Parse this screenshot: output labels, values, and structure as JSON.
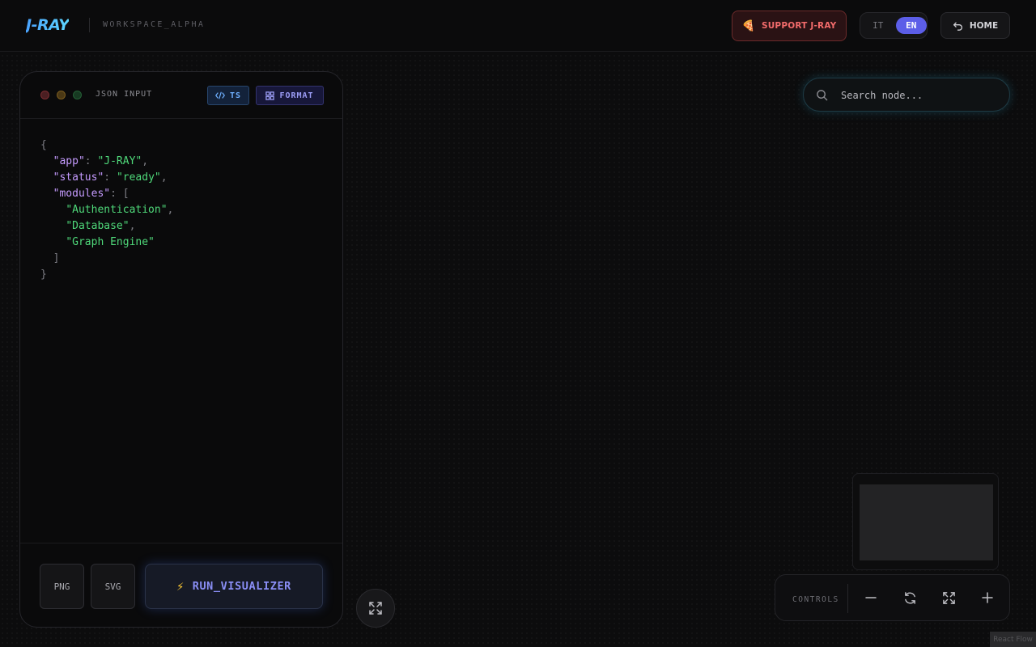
{
  "header": {
    "logo": "J-RAY",
    "workspace": "WORKSPACE_ALPHA",
    "support_label": "SUPPORT J-RAY",
    "languages": [
      {
        "label": "IT",
        "active": false
      },
      {
        "label": "EN",
        "active": true
      }
    ],
    "home_label": "HOME"
  },
  "editor": {
    "title": "JSON INPUT",
    "ts_label": "TS",
    "format_label": "FORMAT",
    "code": {
      "open_brace": "{",
      "app_key": "\"app\"",
      "app_value": "\"J-RAY\"",
      "status_key": "\"status\"",
      "status_value": "\"ready\"",
      "modules_key": "\"modules\"",
      "open_bracket": "[",
      "modules": [
        "\"Authentication\"",
        "\"Database\"",
        "\"Graph Engine\""
      ],
      "close_bracket": "]",
      "close_brace": "}"
    },
    "export_png": "PNG",
    "export_svg": "SVG",
    "run_label": "RUN_VISUALIZER"
  },
  "canvas": {
    "search_placeholder": "Search node...",
    "controls_label": "CONTROLS",
    "attribution": "React Flow"
  },
  "icons": {
    "support": "pizza-icon",
    "home": "return-arrow-icon",
    "ts": "code-icon",
    "format": "grid-icon",
    "run": "lightning-icon",
    "search": "search-icon",
    "fullscreen": "expand-icon",
    "zoom_out": "minus-icon",
    "reset": "refresh-icon",
    "fit": "fit-view-icon",
    "zoom_in": "plus-icon"
  },
  "colors": {
    "accent": "#5c5ee8",
    "logo": "#4aa3ff",
    "support": "#f26b6b",
    "json_key": "#c59bff",
    "json_string": "#4fd97a"
  }
}
